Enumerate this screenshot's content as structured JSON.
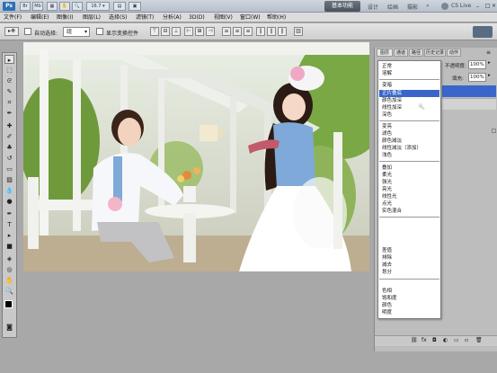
{
  "title_bar": {
    "logo": "Ps",
    "zoom": "16.7",
    "workspace": "基本功能",
    "links": [
      "设计",
      "绘画",
      "摄影"
    ],
    "cslive": "CS Live"
  },
  "menu": [
    "文件(F)",
    "编辑(E)",
    "图像(I)",
    "图层(L)",
    "选择(S)",
    "滤镜(T)",
    "分析(A)",
    "3D(D)",
    "视图(V)",
    "窗口(W)",
    "帮助(H)"
  ],
  "options": {
    "auto_select_label": "自动选择:",
    "auto_select_value": "组",
    "transform_label": "显示变换控件"
  },
  "panel": {
    "tabs": [
      "图层",
      "通道",
      "路径",
      "历史记录",
      "动作"
    ],
    "blend_selected": "正常",
    "opacity_label": "不透明度:",
    "opacity_value": "100%",
    "fill_label": "填充:",
    "fill_value": "100%"
  },
  "blend_modes": [
    [
      "正常",
      "溶解"
    ],
    [
      "变暗",
      "正片叠底",
      "颜色加深",
      "线性加深",
      "深色"
    ],
    [
      "变亮",
      "滤色",
      "颜色减淡",
      "线性减淡（添加）",
      "浅色"
    ],
    [
      "叠加",
      "柔光",
      "强光",
      "亮光",
      "线性光",
      "点光",
      "实色混合"
    ],
    [
      "差值",
      "排除",
      "减去",
      "划分"
    ],
    [
      "色相",
      "饱和度",
      "颜色",
      "明度"
    ]
  ],
  "highlighted_mode": "正片叠底",
  "colors": {
    "accent": "#3a66c9",
    "workspace_btn": "#4a525b"
  }
}
